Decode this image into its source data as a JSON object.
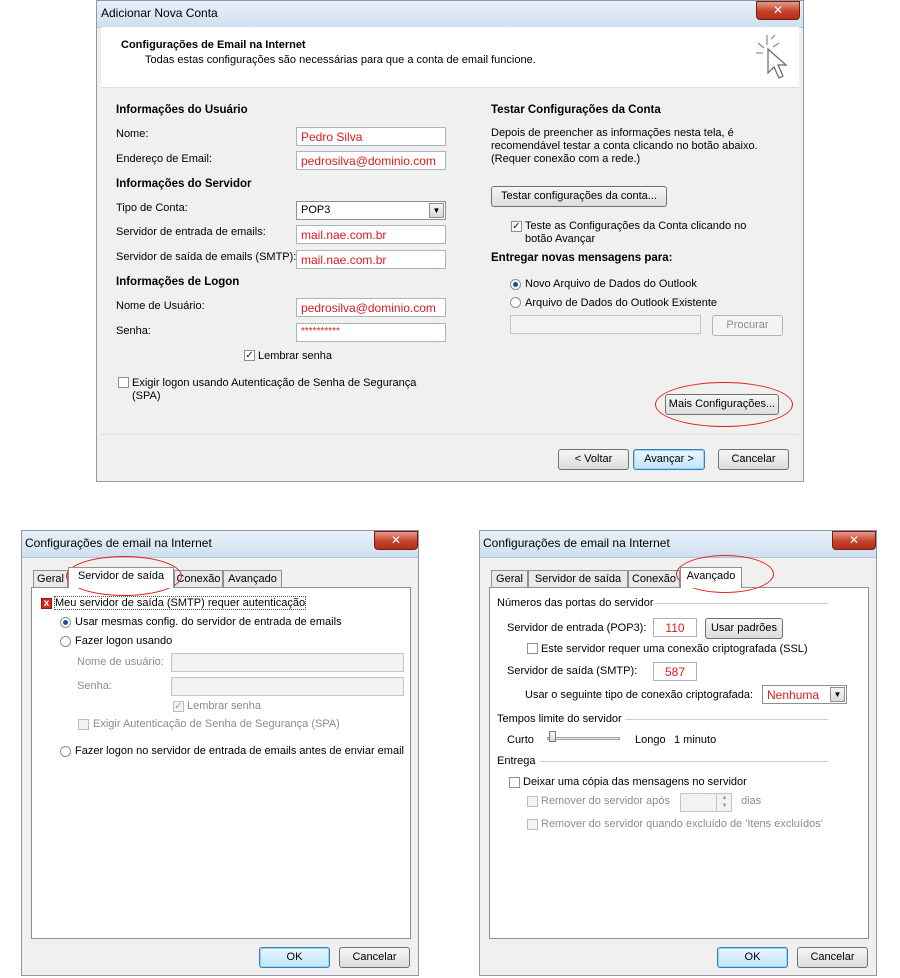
{
  "top_dialog": {
    "title": "Adicionar Nova Conta",
    "close_symbol": "✕",
    "header_title": "Configurações de Email na Internet",
    "header_subtitle": "Todas estas configurações são necessárias para que a conta de email funcione.",
    "cursor_icon": "click-cursor-icon",
    "user_info": {
      "heading": "Informações do Usuário",
      "name_label": "Nome:",
      "name_value": "Pedro Silva",
      "email_label": "Endereço de Email:",
      "email_value": "pedrosilva@dominio.com"
    },
    "server_info": {
      "heading": "Informações do Servidor",
      "account_type_label": "Tipo de Conta:",
      "account_type_value": "POP3",
      "incoming_label": "Servidor de entrada de emails:",
      "incoming_value": "mail.nae.com.br",
      "outgoing_label": "Servidor de saída de emails (SMTP):",
      "outgoing_value": "mail.nae.com.br"
    },
    "logon_info": {
      "heading": "Informações de Logon",
      "username_label": "Nome de Usuário:",
      "username_value": "pedrosilva@dominio.com",
      "password_label": "Senha:",
      "password_value": "**********",
      "remember_label": "Lembrar senha",
      "remember_checked": true,
      "spa_label_1": "Exigir logon usando Autenticação de Senha de Segurança",
      "spa_label_2": "(SPA)",
      "spa_checked": false
    },
    "test": {
      "heading": "Testar Configurações da Conta",
      "desc_1": "Depois de preencher as informações nesta tela, é",
      "desc_2": "recomendável testar a conta clicando no botão abaixo.",
      "desc_3": "(Requer conexão com a rede.)",
      "test_button": "Testar configurações da conta...",
      "auto_test_label_1": "Teste as Configurações da Conta clicando no",
      "auto_test_label_2": "botão Avançar",
      "auto_test_checked": true
    },
    "deliver": {
      "heading": "Entregar novas mensagens para:",
      "option_new": "Novo Arquivo de Dados do Outlook",
      "option_existing": "Arquivo de Dados do Outlook Existente",
      "browse_button": "Procurar"
    },
    "more_settings_button": "Mais Configurações...",
    "back_button": "< Voltar",
    "next_button": "Avançar >",
    "cancel_button": "Cancelar"
  },
  "left_dialog": {
    "title": "Configurações de email na Internet",
    "close_symbol": "✕",
    "tabs": [
      "Geral",
      "Servidor de saída",
      "Conexão",
      "Avançado"
    ],
    "active_tab": "Servidor de saída",
    "requires_auth_label": "Meu servidor de saída (SMTP) requer autenticação",
    "use_same_label": "Usar mesmas config. do servidor de entrada de emails",
    "logon_using_label": "Fazer logon usando",
    "username_label": "Nome de usuário:",
    "password_label": "Senha:",
    "remember_label": "Lembrar senha",
    "require_spa_label": "Exigir Autenticação de Senha de Segurança (SPA)",
    "logon_before_label": "Fazer logon no servidor de entrada de emails antes de enviar email",
    "ok_button": "OK",
    "cancel_button": "Cancelar"
  },
  "right_dialog": {
    "title": "Configurações de email na Internet",
    "close_symbol": "✕",
    "tabs": [
      "Geral",
      "Servidor de saída",
      "Conexão",
      "Avançado"
    ],
    "active_tab": "Avançado",
    "ports_heading": "Números das portas do servidor",
    "incoming_port_label": "Servidor de entrada (POP3):",
    "incoming_port_value": "110",
    "use_defaults_button": "Usar padrões",
    "ssl_label": "Este servidor requer uma conexão criptografada (SSL)",
    "outgoing_port_label": "Servidor de saída (SMTP):",
    "outgoing_port_value": "587",
    "encryption_label": "Usar o seguinte tipo de conexão criptografada:",
    "encryption_value": "Nenhuma",
    "timeouts_heading": "Tempos limite do servidor",
    "short_label": "Curto",
    "long_label": "Longo",
    "timeout_value": "1 minuto",
    "delivery_heading": "Entrega",
    "leave_copy_label": "Deixar uma cópia das mensagens no servidor",
    "remove_after_label": "Remover do servidor após",
    "days_label": "dias",
    "remove_deleted_label": "Remover do servidor quando excluído de 'Itens excluídos'",
    "ok_button": "OK",
    "cancel_button": "Cancelar"
  },
  "colors": {
    "highlight_ellipse": "#e0221a",
    "field_text": "#d91c1c",
    "title_gradient_top": "#e8f1fb"
  }
}
